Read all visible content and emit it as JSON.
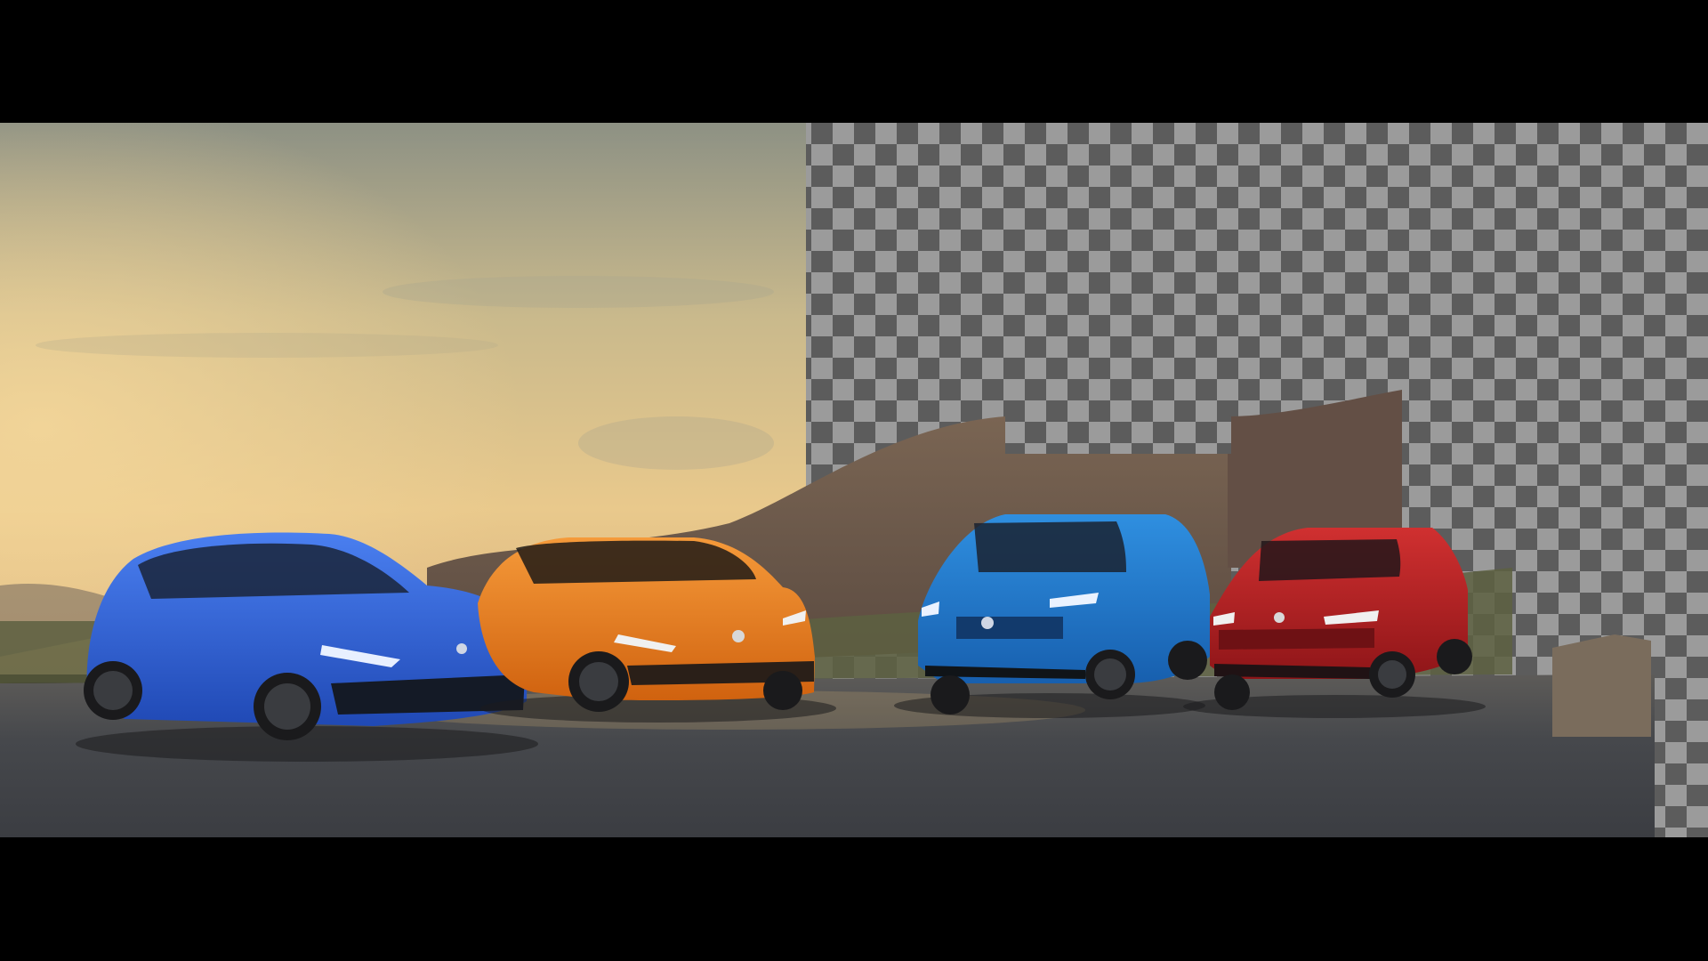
{
  "colors": {
    "letterbox": "#000000",
    "sky_top": "#8f9488",
    "sky_warm": "#e8c98a",
    "checker_light": "#9a9a9a",
    "checker_dark": "#5a5a5a",
    "hill": "#6b5a4e",
    "road": "#4a4c50",
    "car_blue_hatch": "#2f62d6",
    "car_orange": "#e8781c",
    "car_blue_suv": "#1d74c8",
    "car_red": "#b81e22"
  },
  "scene": {
    "cars": [
      {
        "name": "blue-hatchback",
        "color": "#2f62d6"
      },
      {
        "name": "orange-hatchback",
        "color": "#e8781c"
      },
      {
        "name": "blue-suv",
        "color": "#1d74c8"
      },
      {
        "name": "red-estate",
        "color": "#b81e22"
      }
    ],
    "transparency_region": "checkerboard"
  }
}
